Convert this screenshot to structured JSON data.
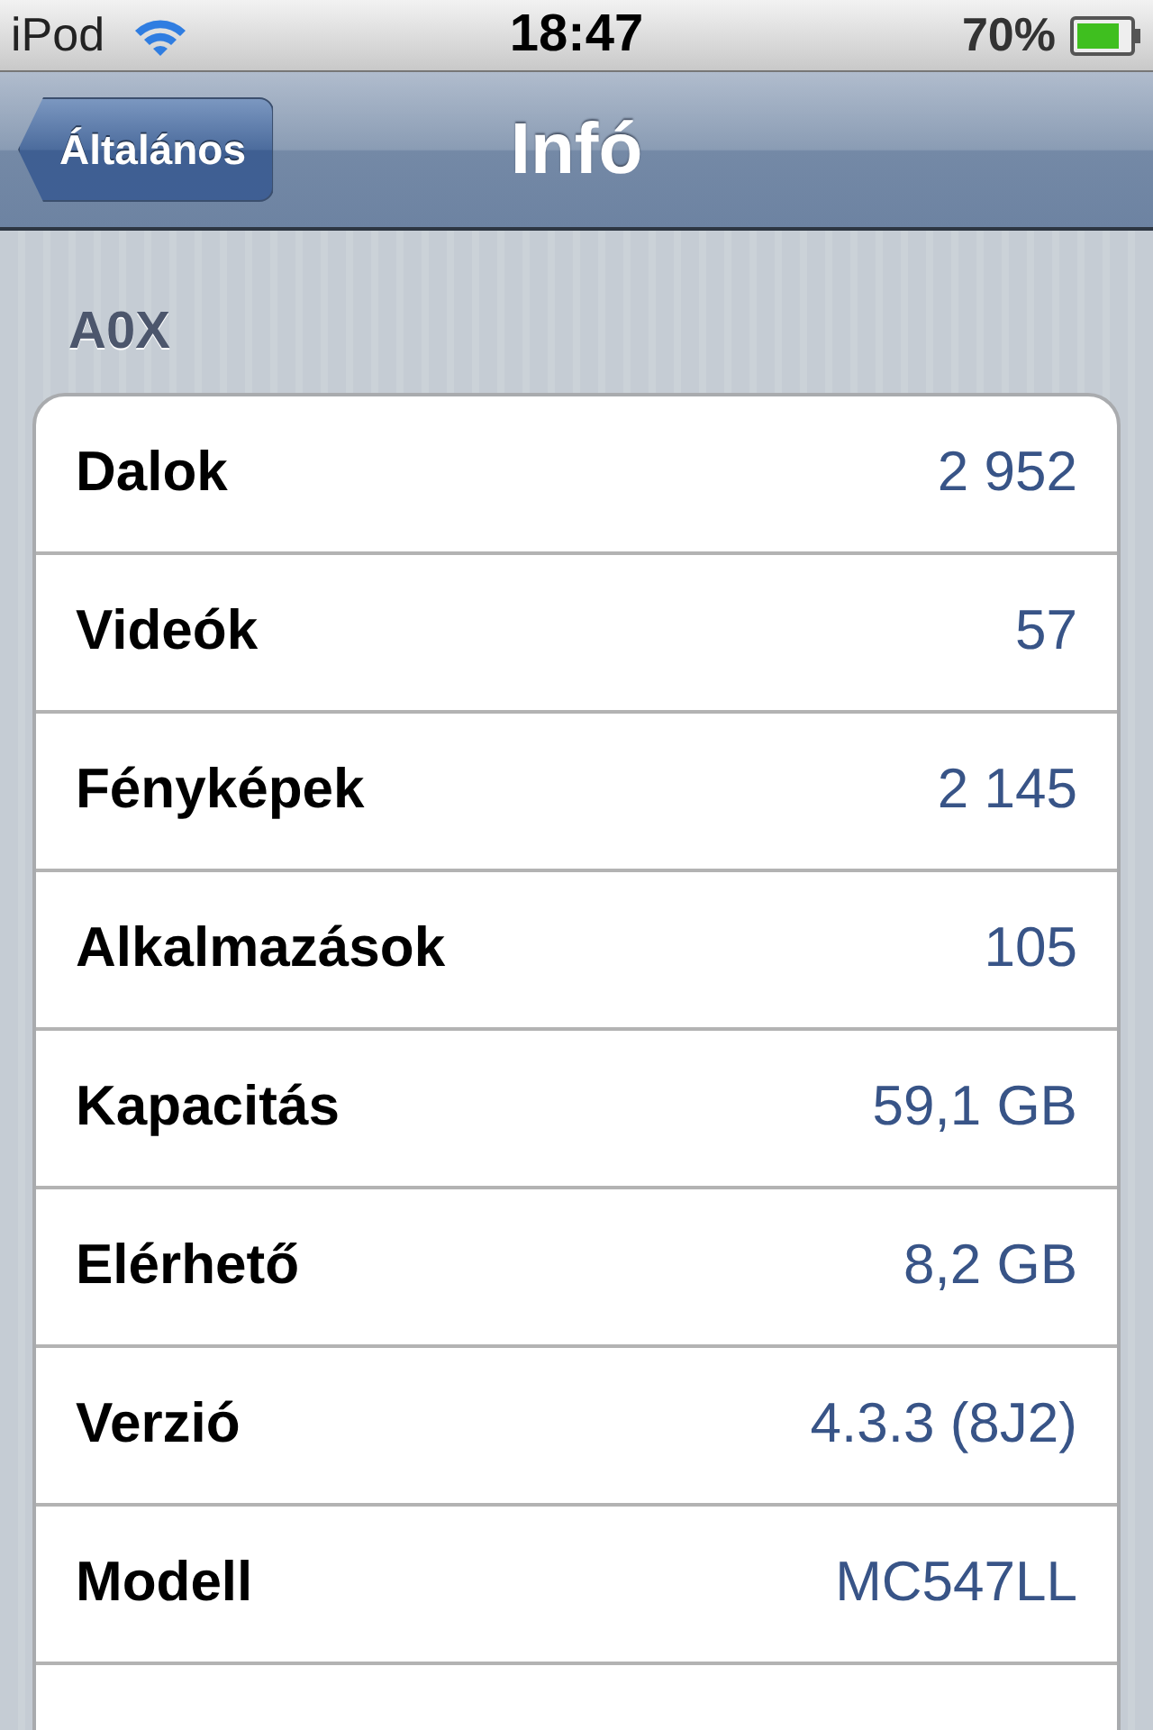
{
  "status_bar": {
    "carrier": "iPod",
    "time": "18:47",
    "battery": "70%"
  },
  "nav_bar": {
    "back_button": "Általános",
    "title": "Infó"
  },
  "section": {
    "header": "A0X",
    "rows": [
      {
        "label": "Dalok",
        "value": "2 952"
      },
      {
        "label": "Videók",
        "value": "57"
      },
      {
        "label": "Fényképek",
        "value": "2 145"
      },
      {
        "label": "Alkalmazások",
        "value": "105"
      },
      {
        "label": "Kapacitás",
        "value": "59,1 GB"
      },
      {
        "label": "Elérhető",
        "value": "8,2 GB"
      },
      {
        "label": "Verzió",
        "value": "4.3.3 (8J2)"
      },
      {
        "label": "Modell",
        "value": "MC547LL"
      }
    ]
  }
}
